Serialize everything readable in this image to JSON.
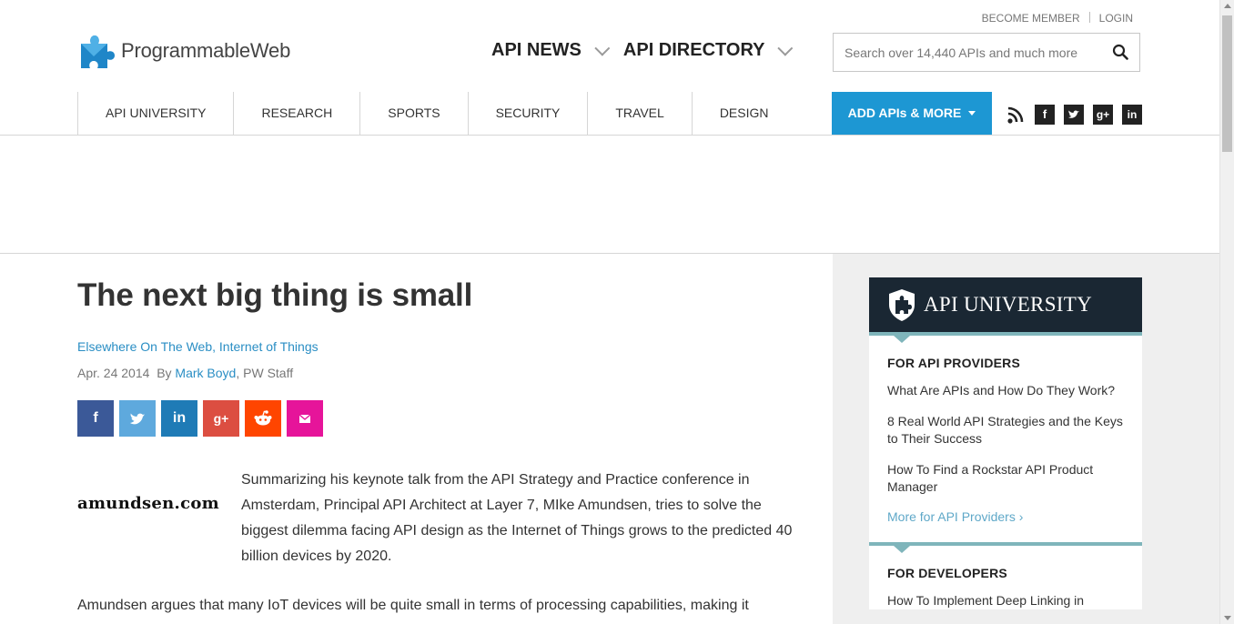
{
  "header": {
    "logo_text": "ProgrammableWeb",
    "top_links": [
      "BECOME MEMBER",
      "LOGIN"
    ],
    "main_nav": [
      "API NEWS",
      "API DIRECTORY"
    ],
    "search_placeholder": "Search over 14,440 APIs and much more"
  },
  "category_nav": {
    "items": [
      "API UNIVERSITY",
      "RESEARCH",
      "SPORTS",
      "SECURITY",
      "TRAVEL",
      "DESIGN"
    ],
    "add_button": "ADD APIs & MORE",
    "social_icons": [
      "rss-icon",
      "facebook-icon",
      "twitter-icon",
      "google-plus-icon",
      "linkedin-icon"
    ]
  },
  "article": {
    "title": "The next big thing is small",
    "tag1": "Elsewhere On The Web",
    "tag2": "Internet of Things",
    "date": "Apr. 24 2014",
    "by": "By",
    "author": "Mark Boyd",
    "author_role": ", PW Staff",
    "share_buttons": [
      {
        "name": "facebook",
        "color": "#3b5998"
      },
      {
        "name": "twitter",
        "color": "#5ea9dd"
      },
      {
        "name": "linkedin",
        "color": "#1f7bb6"
      },
      {
        "name": "google-plus",
        "color": "#dc4e41"
      },
      {
        "name": "reddit",
        "color": "#ff4500"
      },
      {
        "name": "email",
        "color": "#e6149a"
      }
    ],
    "image_text": "amundsen.com",
    "intro": "Summarizing his keynote talk from the API Strategy and Practice conference in Amsterdam, Principal API Architect at Layer 7, MIke Amundsen, tries to solve the biggest dilemma facing API design as the Internet of Things grows to the predicted 40 billion devices by 2020.",
    "para2": "Amundsen argues that many IoT devices will be quite small in terms of processing capabilities, making it"
  },
  "sidebar": {
    "title": "API UNIVERSITY",
    "providers_heading": "FOR API PROVIDERS",
    "providers_links": [
      "What Are APIs and How Do They Work?",
      "8 Real World API Strategies and the Keys to Their Success",
      "How To Find a Rockstar API Product Manager"
    ],
    "providers_more": "More for API Providers",
    "developers_heading": "FOR DEVELOPERS",
    "developers_links": [
      "How To Implement Deep Linking in"
    ]
  },
  "colors": {
    "accent_blue": "#1d97d3",
    "link_blue": "#2a8ec4",
    "sidebar_header": "#1a2733",
    "sidebar_bar": "#7fb5bb"
  }
}
